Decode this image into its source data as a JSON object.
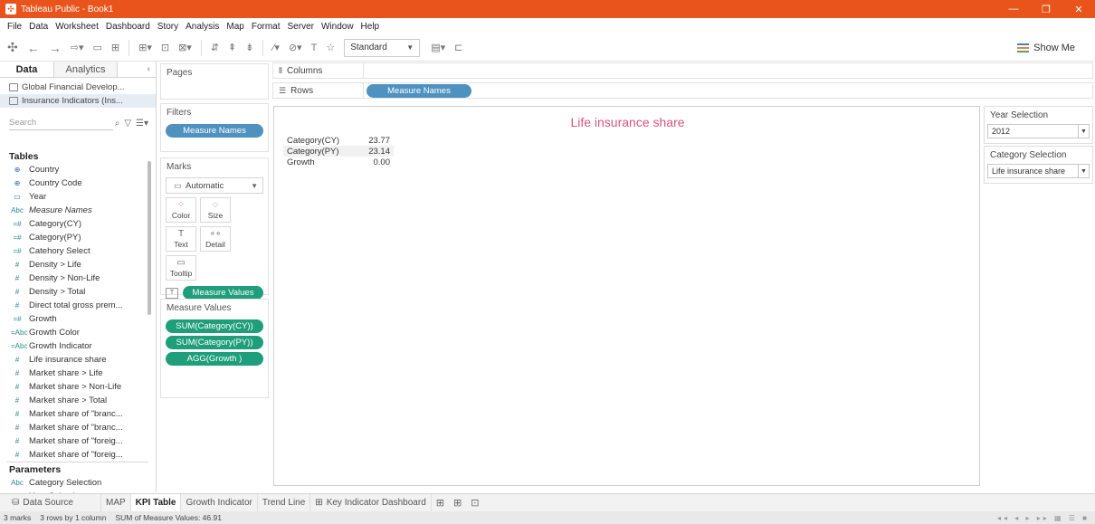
{
  "window": {
    "title": "Tableau Public - Book1",
    "minimize": "—",
    "restore": "❐",
    "close": "✕"
  },
  "menu": [
    "File",
    "Data",
    "Worksheet",
    "Dashboard",
    "Story",
    "Analysis",
    "Map",
    "Format",
    "Server",
    "Window",
    "Help"
  ],
  "toolbar": {
    "fit_select": "Standard",
    "show_me": "Show Me"
  },
  "data_pane": {
    "tab_data": "Data",
    "tab_analytics": "Analytics",
    "sources": [
      "Global Financial Develop...",
      "Insurance Indicators (Ins..."
    ],
    "search_placeholder": "Search",
    "tables_header": "Tables",
    "fields": [
      {
        "icon": "⊕",
        "name": "Country"
      },
      {
        "icon": "⊕",
        "name": "Country Code"
      },
      {
        "icon": "▭",
        "name": "Year"
      },
      {
        "icon": "Abc",
        "name": "Measure Names"
      },
      {
        "icon": "=#",
        "name": "Category(CY)"
      },
      {
        "icon": "=#",
        "name": "Category(PY)"
      },
      {
        "icon": "=#",
        "name": "Catehory Select"
      },
      {
        "icon": "#",
        "name": "Density > Life"
      },
      {
        "icon": "#",
        "name": "Density > Non-Life"
      },
      {
        "icon": "#",
        "name": "Density > Total"
      },
      {
        "icon": "#",
        "name": "Direct total gross prem..."
      },
      {
        "icon": "=#",
        "name": "Growth"
      },
      {
        "icon": "=Abc",
        "name": "Growth Color"
      },
      {
        "icon": "=Abc",
        "name": "Growth Indicator"
      },
      {
        "icon": "#",
        "name": "Life insurance share"
      },
      {
        "icon": "#",
        "name": "Market share > Life"
      },
      {
        "icon": "#",
        "name": "Market share > Non-Life"
      },
      {
        "icon": "#",
        "name": "Market share > Total"
      },
      {
        "icon": "#",
        "name": "Market share of \"branc..."
      },
      {
        "icon": "#",
        "name": "Market share of \"branc..."
      },
      {
        "icon": "#",
        "name": "Market share of \"foreig..."
      },
      {
        "icon": "#",
        "name": "Market share of \"foreig..."
      }
    ],
    "parameters_header": "Parameters",
    "parameters": [
      {
        "icon": "Abc",
        "name": "Category Selection"
      },
      {
        "icon": "▭",
        "name": "Year Selection"
      }
    ]
  },
  "shelves": {
    "pages": "Pages",
    "filters": "Filters",
    "filter_pill": "Measure Names",
    "marks": "Marks",
    "mark_type": "Automatic",
    "mark_buttons": [
      {
        "glyph": "⁘",
        "label": "Color"
      },
      {
        "glyph": "◌",
        "label": "Size"
      },
      {
        "glyph": "T",
        "label": "Text"
      },
      {
        "glyph": "∘∘",
        "label": "Detail"
      },
      {
        "glyph": "▭",
        "label": "Tooltip"
      }
    ],
    "marks_pill": "Measure Values",
    "measure_values_header": "Measure Values",
    "measure_values_pills": [
      "SUM(Category(CY))",
      "SUM(Category(PY))",
      "AGG(Growth )"
    ],
    "columns_label": "Columns",
    "rows_label": "Rows",
    "rows_pill": "Measure Names"
  },
  "view": {
    "title": "Life insurance share",
    "rows": [
      {
        "name": "Category(CY)",
        "value": "23.77"
      },
      {
        "name": "Category(PY)",
        "value": "23.14"
      },
      {
        "name": "Growth",
        "value": "0.00"
      }
    ]
  },
  "filters_panel": {
    "year_label": "Year Selection",
    "year_value": "2012",
    "category_label": "Category Selection",
    "category_value": "Life insurance share"
  },
  "sheet_tabs": {
    "data_source": "Data Source",
    "tabs": [
      "MAP",
      "KPI Table",
      "Growth Indicator",
      "Trend Line",
      "Key Indicator Dashboard"
    ],
    "active": "KPI Table"
  },
  "status": {
    "marks": "3 marks",
    "rows": "3 rows by 1 column",
    "sum": "SUM of Measure Values: 46.91"
  }
}
